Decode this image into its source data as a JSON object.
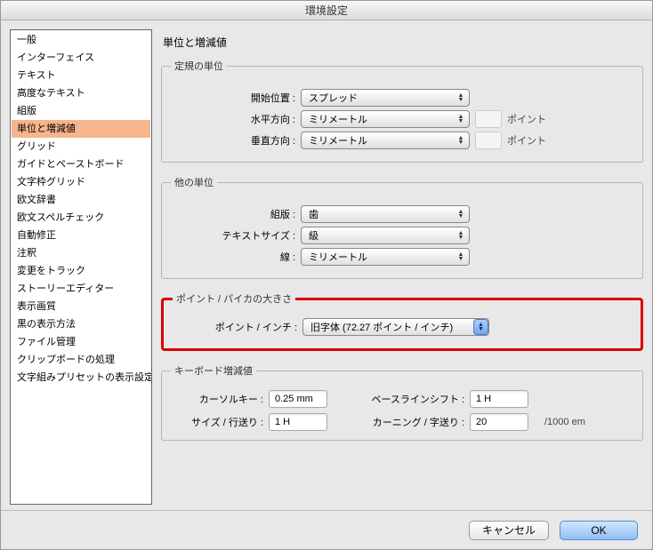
{
  "window": {
    "title": "環境設定"
  },
  "sidebar": {
    "items": [
      "一般",
      "インターフェイス",
      "テキスト",
      "高度なテキスト",
      "組版",
      "単位と増減値",
      "グリッド",
      "ガイドとペーストボード",
      "文字枠グリッド",
      "欧文辞書",
      "欧文スペルチェック",
      "自動修正",
      "注釈",
      "変更をトラック",
      "ストーリーエディター",
      "表示画質",
      "黒の表示方法",
      "ファイル管理",
      "クリップボードの処理",
      "文字組みプリセットの表示設定"
    ],
    "selected_index": 5
  },
  "main": {
    "heading": "単位と増減値",
    "ruler": {
      "legend": "定規の単位",
      "origin": {
        "label": "開始位置 :",
        "value": "スプレッド"
      },
      "horizontal": {
        "label": "水平方向 :",
        "value": "ミリメートル",
        "suffix": "ポイント"
      },
      "vertical": {
        "label": "垂直方向 :",
        "value": "ミリメートル",
        "suffix": "ポイント"
      }
    },
    "other": {
      "legend": "他の単位",
      "typesetting": {
        "label": "組版 :",
        "value": "歯"
      },
      "textsize": {
        "label": "テキストサイズ :",
        "value": "級"
      },
      "stroke": {
        "label": "線 :",
        "value": "ミリメートル"
      }
    },
    "pointpica": {
      "legend": "ポイント / パイカの大きさ",
      "label": "ポイント / インチ :",
      "value": "旧字体 (72.27 ポイント / インチ)"
    },
    "keyboard": {
      "legend": "キーボード増減値",
      "cursor": {
        "label": "カーソルキー :",
        "value": "0.25 mm"
      },
      "baseline": {
        "label": "ベースラインシフト :",
        "value": "1 H"
      },
      "size": {
        "label": "サイズ / 行送り :",
        "value": "1 H"
      },
      "kerning": {
        "label": "カーニング / 字送り :",
        "value": "20",
        "unit": "/1000 em"
      }
    }
  },
  "footer": {
    "cancel": "キャンセル",
    "ok": "OK"
  }
}
